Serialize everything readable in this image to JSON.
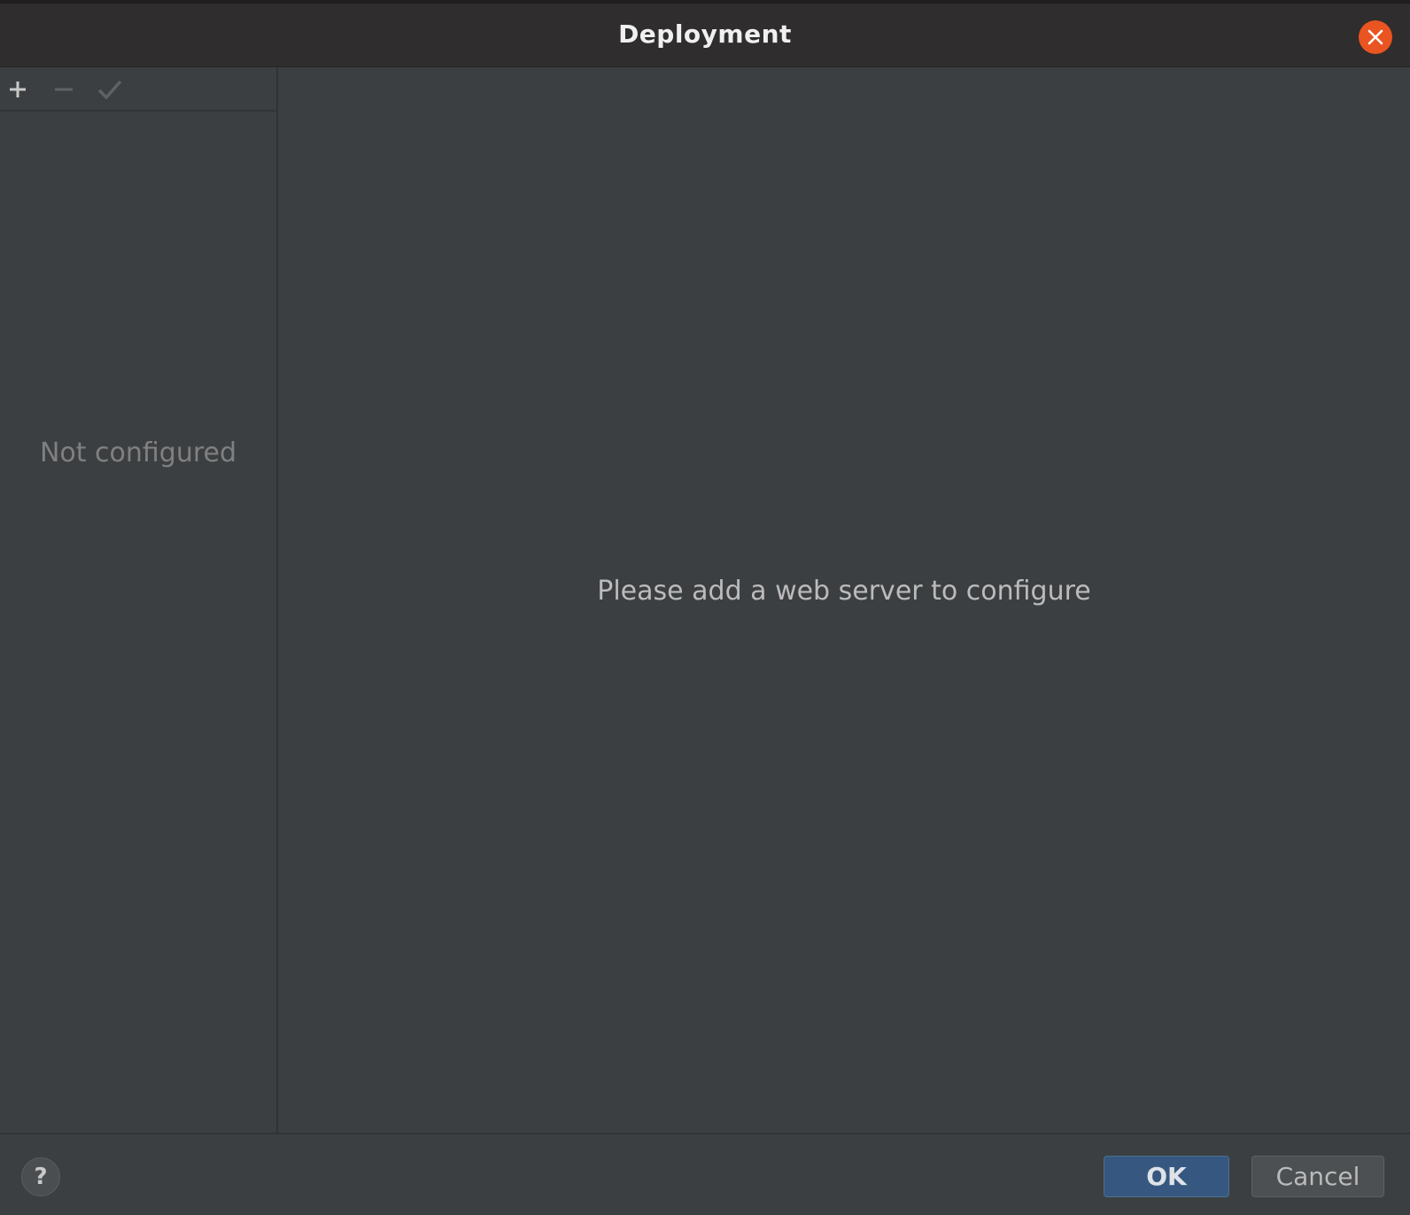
{
  "window": {
    "title": "Deployment"
  },
  "toolbar": {
    "add": "add-icon",
    "remove": "remove-icon",
    "apply": "check-icon"
  },
  "left_panel": {
    "empty_text": "Not configured"
  },
  "right_panel": {
    "empty_text": "Please add a web server to configure"
  },
  "footer": {
    "help_label": "?",
    "ok_label": "OK",
    "cancel_label": "Cancel"
  },
  "colors": {
    "close_button": "#e95420",
    "ok_button": "#365880"
  }
}
